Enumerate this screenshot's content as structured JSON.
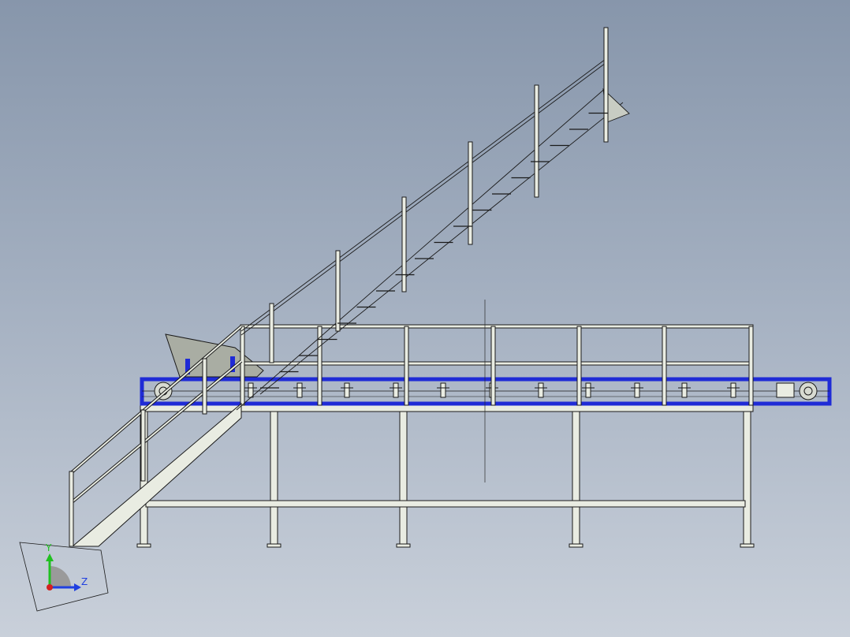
{
  "viewport": {
    "background_top": "#8796ab",
    "background_bottom": "#c9d0da"
  },
  "model": {
    "frame_color": "#1f2bd6",
    "steel_color": "#e9ece2",
    "edge_color": "#1a1a1a",
    "hopper_color": "#a9ada3"
  },
  "triad": {
    "y_label": "Y",
    "z_label": "Z",
    "x_color": "#d42020",
    "y_color": "#20c020",
    "z_color": "#2040e0"
  }
}
